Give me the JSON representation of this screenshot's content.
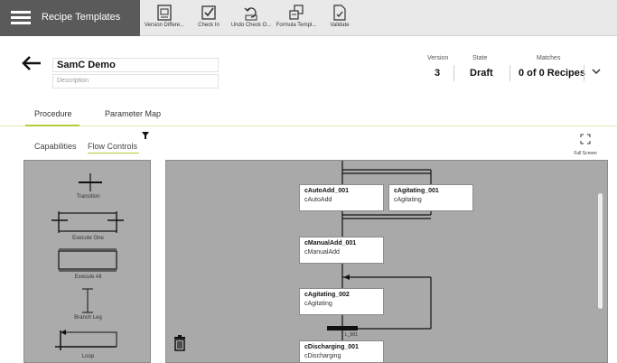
{
  "toolbar": {
    "app_title": "Recipe Templates",
    "tools": [
      {
        "label": "Version Differe...",
        "icon": "version-difference-icon"
      },
      {
        "label": "Check In",
        "icon": "check-in-icon"
      },
      {
        "label": "Undo Check O...",
        "icon": "undo-check-out-icon"
      },
      {
        "label": "Formula Templ...",
        "icon": "formula-template-icon"
      },
      {
        "label": "Validate",
        "icon": "validate-icon"
      }
    ]
  },
  "header": {
    "name": "SamC Demo",
    "description_placeholder": "Description",
    "version_label": "Version",
    "version_value": "3",
    "state_label": "State",
    "state_value": "Draft",
    "matches_label": "Matches",
    "matches_value": "0 of 0 Recipes"
  },
  "tabs": [
    {
      "label": "Procedure",
      "active": true
    },
    {
      "label": "Parameter Map",
      "active": false
    }
  ],
  "subtabs": [
    {
      "label": "Capabilities",
      "active": false
    },
    {
      "label": "Flow Controls",
      "active": true
    }
  ],
  "fullscreen_label": "Full Screen",
  "palette": {
    "items": [
      "Transition",
      "Execute One",
      "Execute All",
      "Branch Leg",
      "Loop"
    ]
  },
  "canvas": {
    "steps": [
      {
        "name": "cAutoAdd_001",
        "type": "cAutoAdd"
      },
      {
        "name": "cAgitating_001",
        "type": "cAgitating"
      },
      {
        "name": "cManualAdd_001",
        "type": "cManualAdd"
      },
      {
        "name": "cAgitating_002",
        "type": "cAgitating"
      },
      {
        "name": "cDischarging_001",
        "type": "cDischarging"
      }
    ],
    "transition_label": "L_001"
  },
  "colors": {
    "app_block": "#5a5a5a",
    "toolbar": "#e9e9e9",
    "accent": "#b5cc3a",
    "canvas": "#a9a9a9",
    "palette": "#ababab"
  }
}
